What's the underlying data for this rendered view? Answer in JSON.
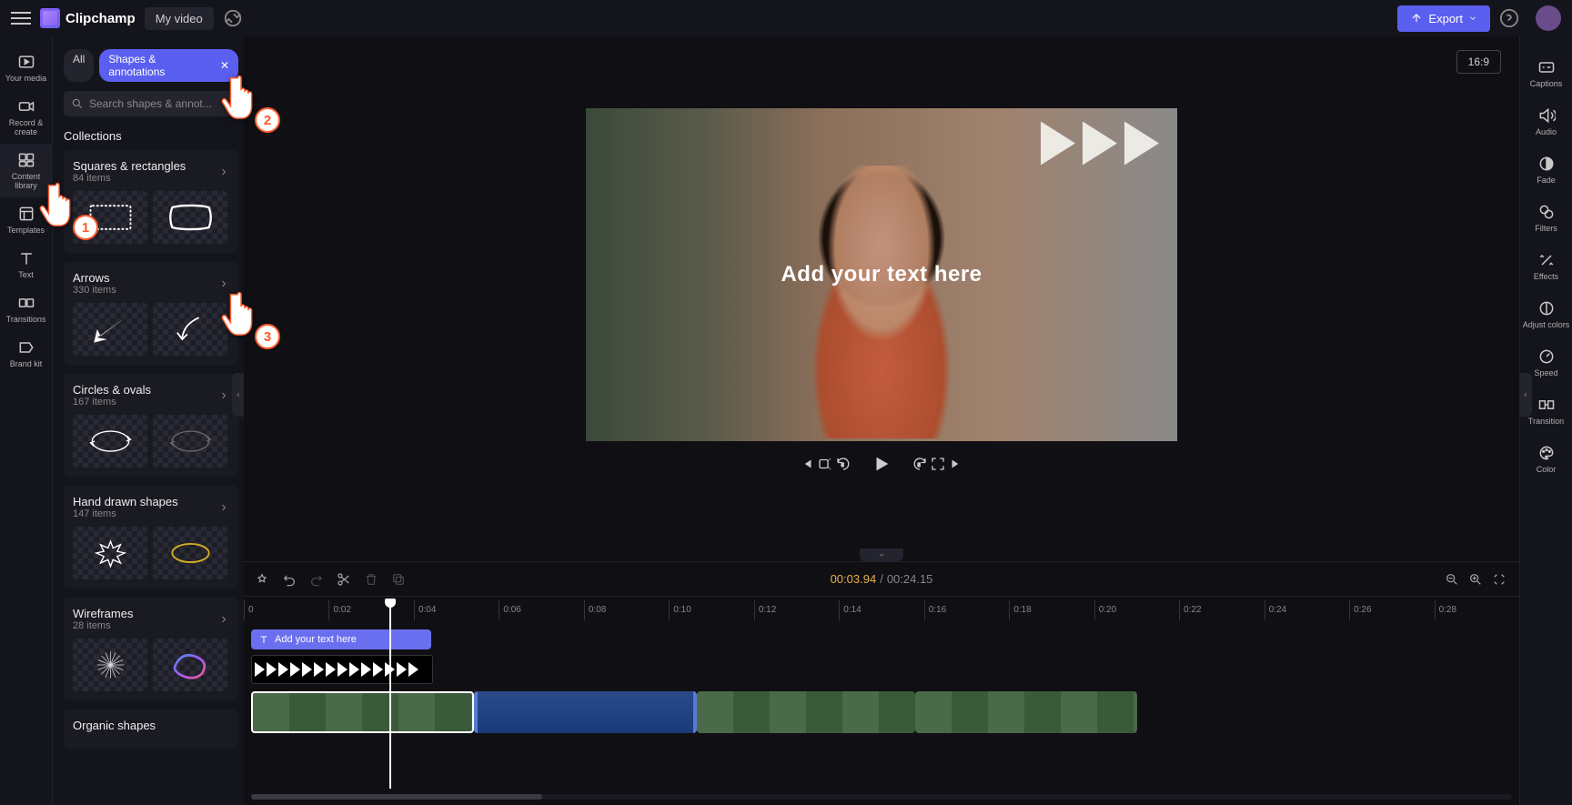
{
  "app": {
    "name": "Clipchamp",
    "video_title": "My video"
  },
  "export_button": "Export",
  "aspect_ratio": "16:9",
  "left_rail": [
    {
      "id": "your-media",
      "label": "Your media"
    },
    {
      "id": "record-create",
      "label": "Record & create"
    },
    {
      "id": "content-library",
      "label": "Content library",
      "active": true
    },
    {
      "id": "templates",
      "label": "Templates"
    },
    {
      "id": "text",
      "label": "Text"
    },
    {
      "id": "transitions",
      "label": "Transitions"
    },
    {
      "id": "brand-kit",
      "label": "Brand kit"
    }
  ],
  "panel": {
    "chips": {
      "all": "All",
      "active": "Shapes & annotations"
    },
    "search_placeholder": "Search shapes & annot...",
    "section_title": "Collections",
    "collections": [
      {
        "name": "Squares & rectangles",
        "count": "84 items"
      },
      {
        "name": "Arrows",
        "count": "330 items"
      },
      {
        "name": "Circles & ovals",
        "count": "167 items"
      },
      {
        "name": "Hand drawn shapes",
        "count": "147 items"
      },
      {
        "name": "Wireframes",
        "count": "28 items"
      },
      {
        "name": "Organic shapes",
        "count": ""
      }
    ]
  },
  "canvas_text": "Add your text here",
  "timeline": {
    "current": "00:03.94",
    "total": "00:24.15",
    "ruler": [
      "0",
      "0:02",
      "0:04",
      "0:06",
      "0:08",
      "0:10",
      "0:12",
      "0:14",
      "0:16",
      "0:18",
      "0:20",
      "0:22",
      "0:24",
      "0:26",
      "0:28"
    ],
    "text_clip_label": "Add your text here"
  },
  "right_rail": [
    {
      "id": "captions",
      "label": "Captions"
    },
    {
      "id": "audio",
      "label": "Audio"
    },
    {
      "id": "fade",
      "label": "Fade"
    },
    {
      "id": "filters",
      "label": "Filters"
    },
    {
      "id": "effects",
      "label": "Effects"
    },
    {
      "id": "adjust-colors",
      "label": "Adjust colors"
    },
    {
      "id": "speed",
      "label": "Speed"
    },
    {
      "id": "transition",
      "label": "Transition"
    },
    {
      "id": "color",
      "label": "Color"
    }
  ],
  "cursors": [
    {
      "n": "1"
    },
    {
      "n": "2"
    },
    {
      "n": "3"
    }
  ]
}
